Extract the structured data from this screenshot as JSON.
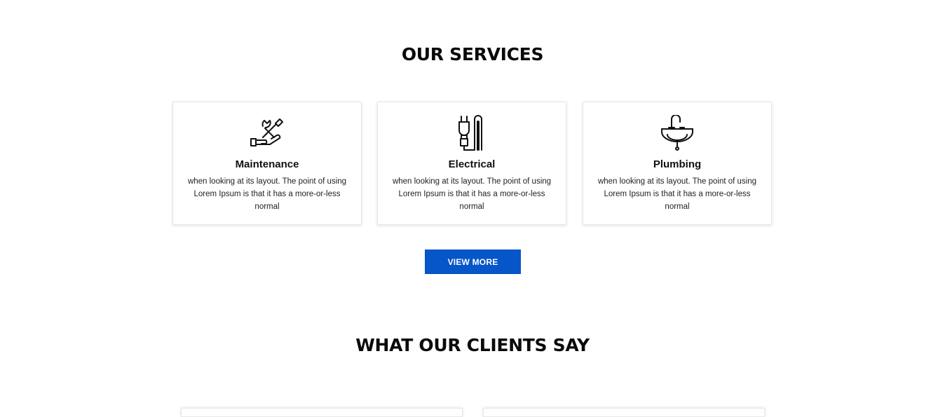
{
  "services": {
    "title": "OUR SERVICES",
    "items": [
      {
        "icon": "wrench-screwdriver-hand-icon",
        "title": "Maintenance",
        "description": "when looking at its layout. The point of using Lorem Ipsum is that it has a more-or-less normal"
      },
      {
        "icon": "electrical-plug-icon",
        "title": "Electrical",
        "description": "when looking at its layout. The point of using Lorem Ipsum is that it has a more-or-less normal"
      },
      {
        "icon": "sink-faucet-icon",
        "title": "Plumbing",
        "description": "when looking at its layout. The point of using Lorem Ipsum is that it has a more-or-less normal"
      }
    ],
    "view_more_label": "VIEW MORE"
  },
  "clients": {
    "title": "WHAT OUR CLIENTS SAY"
  },
  "colors": {
    "accent": "#0656c9",
    "text": "#0a0a0a",
    "card_border": "#e6e6e6"
  }
}
